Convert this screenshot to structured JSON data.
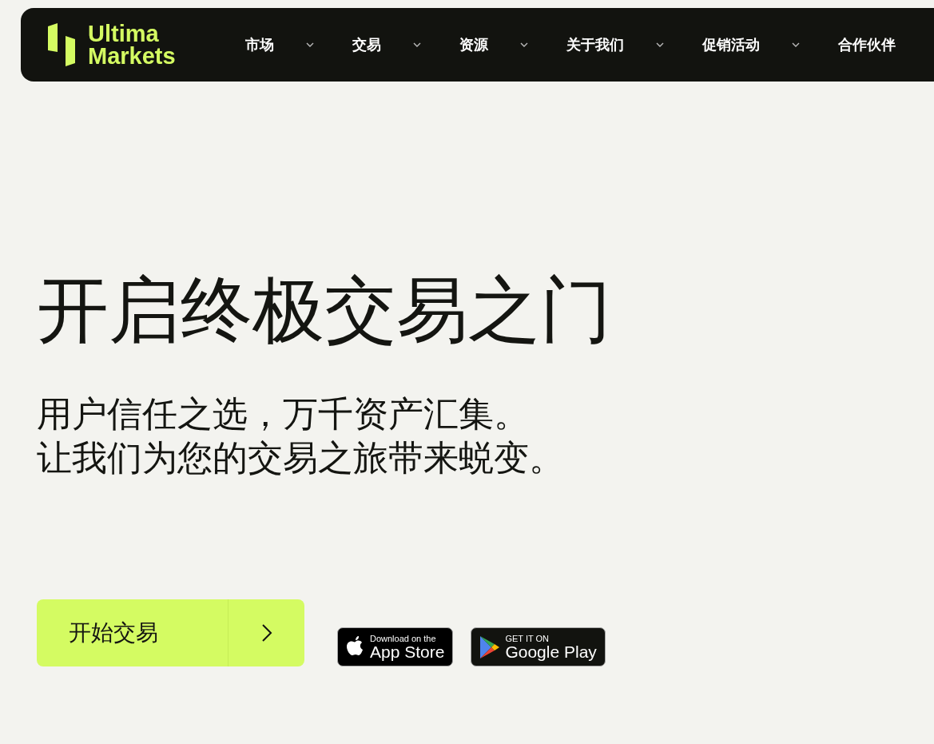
{
  "header": {
    "logo": {
      "line_1": "Ultima",
      "line_2": "Markets"
    },
    "nav": [
      {
        "label": "市场",
        "has_menu": true
      },
      {
        "label": "交易",
        "has_menu": true
      },
      {
        "label": "资源",
        "has_menu": true
      },
      {
        "label": "关于我们",
        "has_menu": true
      },
      {
        "label": "促销活动",
        "has_menu": true
      },
      {
        "label": "合作伙伴",
        "has_menu": false
      }
    ]
  },
  "hero": {
    "title": "开启终极交易之门",
    "subtitle_lines": [
      "用户信任之选，万千资产汇集。",
      "让我们为您的交易之旅带来蜕变。"
    ],
    "cta": {
      "label": "开始交易"
    },
    "badges": [
      {
        "kind": "apple",
        "small": "Download on the",
        "large": "App Store"
      },
      {
        "kind": "google",
        "small": "GET IT ON",
        "large": "Google Play"
      }
    ]
  }
}
